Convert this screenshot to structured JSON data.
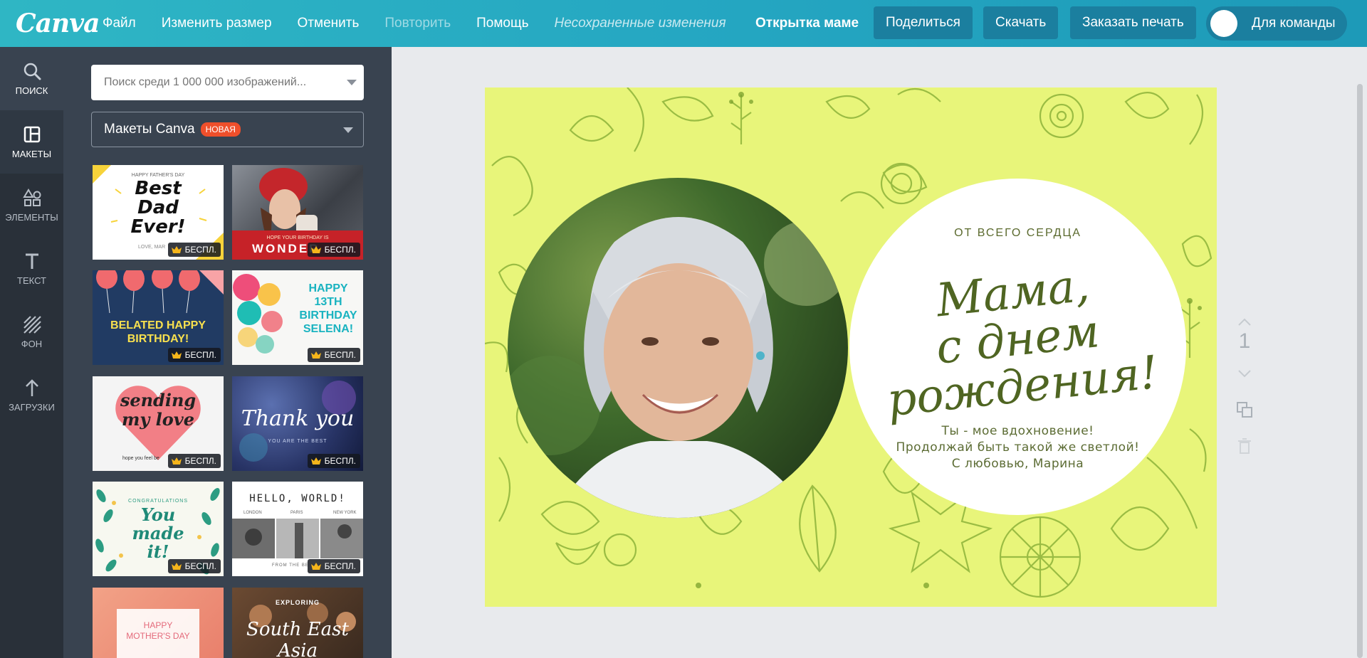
{
  "app": {
    "logo": "Canva",
    "menu": [
      {
        "label": "Файл",
        "disabled": false
      },
      {
        "label": "Изменить размер",
        "disabled": false
      },
      {
        "label": "Отменить",
        "disabled": false
      },
      {
        "label": "Повторить",
        "disabled": true
      },
      {
        "label": "Помощь",
        "disabled": false
      }
    ],
    "status": "Несохраненные изменения",
    "design_title": "Открытка маме",
    "actions": {
      "share": "Поделиться",
      "download": "Скачать",
      "print": "Заказать печать",
      "team": "Для команды"
    }
  },
  "sidenav": [
    {
      "label": "ПОИСК",
      "icon": "search-icon"
    },
    {
      "label": "МАКЕТЫ",
      "icon": "layouts-icon"
    },
    {
      "label": "ЭЛЕМЕНТЫ",
      "icon": "elements-icon"
    },
    {
      "label": "ТЕКСТ",
      "icon": "text-icon"
    },
    {
      "label": "ФОН",
      "icon": "background-icon"
    },
    {
      "label": "ЗАГРУЗКИ",
      "icon": "upload-icon"
    }
  ],
  "panel": {
    "search_placeholder": "Поиск среди 1 000 000 изображений...",
    "select_value": "Макеты Canva",
    "new_badge": "НОВАЯ",
    "free_label": "БЕСПЛ.",
    "templates": [
      {
        "lines": [
          "HAPPY FATHER'S DAY",
          "Best",
          "Dad",
          "Ever!",
          "LOVE, MAR"
        ]
      },
      {
        "lines": [
          "HOPE YOUR BIRTHDAY IS",
          "WONDER"
        ]
      },
      {
        "lines": [
          "BELATED HAPPY",
          "BIRTHDAY!"
        ]
      },
      {
        "lines": [
          "HAPPY",
          "13TH",
          "BIRTHDAY",
          "SELENA!"
        ]
      },
      {
        "lines": [
          "sending",
          "my love",
          "hope you feel be"
        ]
      },
      {
        "lines": [
          "Thank you",
          "YOU ARE THE BEST"
        ]
      },
      {
        "lines": [
          "CONGRATULATIONS",
          "You",
          "made",
          "it!"
        ]
      },
      {
        "lines": [
          "HELLO, WORLD!",
          "LONDON",
          "PARIS",
          "NEW YORK",
          "FROM THE BE"
        ]
      },
      {
        "lines": [
          "HAPPY",
          "MOTHER'S DAY"
        ]
      },
      {
        "lines": [
          "EXPLORING",
          "South East Asia"
        ]
      }
    ]
  },
  "card": {
    "eyebrow": "ОТ ВСЕГО СЕРДЦА",
    "heading_lines": [
      "Мама,",
      "с днем",
      "рождения!"
    ],
    "message_lines": [
      "Ты - мое вдохновение!",
      "Продолжай быть такой же светлой!",
      "С любовью, Марина"
    ]
  },
  "pager": {
    "page": "1"
  },
  "colors": {
    "topbar": "#25a7c2",
    "card_background": "#e8f57a",
    "accent_badge": "#ef4f2b"
  }
}
